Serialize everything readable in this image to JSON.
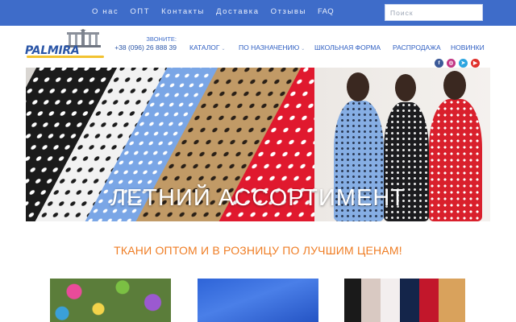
{
  "topbar": {
    "nav": [
      "О нас",
      "ОПТ",
      "Контакты",
      "Доставка",
      "Отзывы",
      "FAQ"
    ],
    "search_placeholder": "Поиск"
  },
  "header": {
    "logo_text": "PALMIRA",
    "call_label": "ЗВОНИТЕ:",
    "phone": "+38 (096) 26 888 39",
    "menu": [
      {
        "label": "КАТАЛОГ",
        "has_dropdown": true
      },
      {
        "label": "ПО НАЗНАЧЕНИЮ",
        "has_dropdown": true
      },
      {
        "label": "ШКОЛЬНАЯ ФОРМА",
        "has_dropdown": false
      },
      {
        "label": "РАСПРОДАЖА",
        "has_dropdown": false
      },
      {
        "label": "НОВИНКИ",
        "has_dropdown": false
      }
    ],
    "socials": [
      {
        "icon": "facebook-icon",
        "color": "#3b5998"
      },
      {
        "icon": "instagram-icon",
        "color": "#c13584"
      },
      {
        "icon": "telegram-icon",
        "color": "#2ca5e0"
      },
      {
        "icon": "youtube-icon",
        "color": "#e0302b"
      }
    ]
  },
  "banner": {
    "title": "ЛЕТНИЙ АССОРТИМЕНТ"
  },
  "tagline": "ТКАНИ ОПТОМ И В РОЗНИЦУ ПО ЛУЧШИМ ЦЕНАМ!",
  "colors": {
    "topbar": "#3e6cc9",
    "accent_orange": "#ef7d24",
    "nav_blue": "#2f5fc2"
  }
}
